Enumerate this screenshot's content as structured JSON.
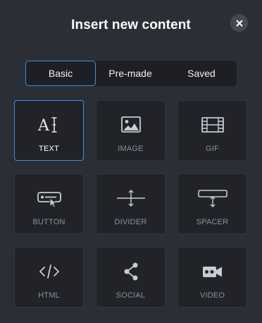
{
  "dialog": {
    "title": "Insert new content",
    "close_icon": "close-icon"
  },
  "tabs": [
    {
      "label": "Basic",
      "active": true
    },
    {
      "label": "Pre-made",
      "active": false
    },
    {
      "label": "Saved",
      "active": false
    }
  ],
  "items": [
    {
      "label": "TEXT",
      "icon": "text-icon",
      "active": true
    },
    {
      "label": "IMAGE",
      "icon": "image-icon",
      "active": false
    },
    {
      "label": "GIF",
      "icon": "film-icon",
      "active": false
    },
    {
      "label": "BUTTON",
      "icon": "button-icon",
      "active": false
    },
    {
      "label": "DIVIDER",
      "icon": "divider-icon",
      "active": false
    },
    {
      "label": "SPACER",
      "icon": "spacer-icon",
      "active": false
    },
    {
      "label": "HTML",
      "icon": "code-icon",
      "active": false
    },
    {
      "label": "SOCIAL",
      "icon": "share-icon",
      "active": false
    },
    {
      "label": "VIDEO",
      "icon": "video-icon",
      "active": false
    }
  ],
  "colors": {
    "accent": "#3b91e0",
    "background": "#2b2e35",
    "card": "#212329",
    "icon": "#c9ccd2"
  }
}
